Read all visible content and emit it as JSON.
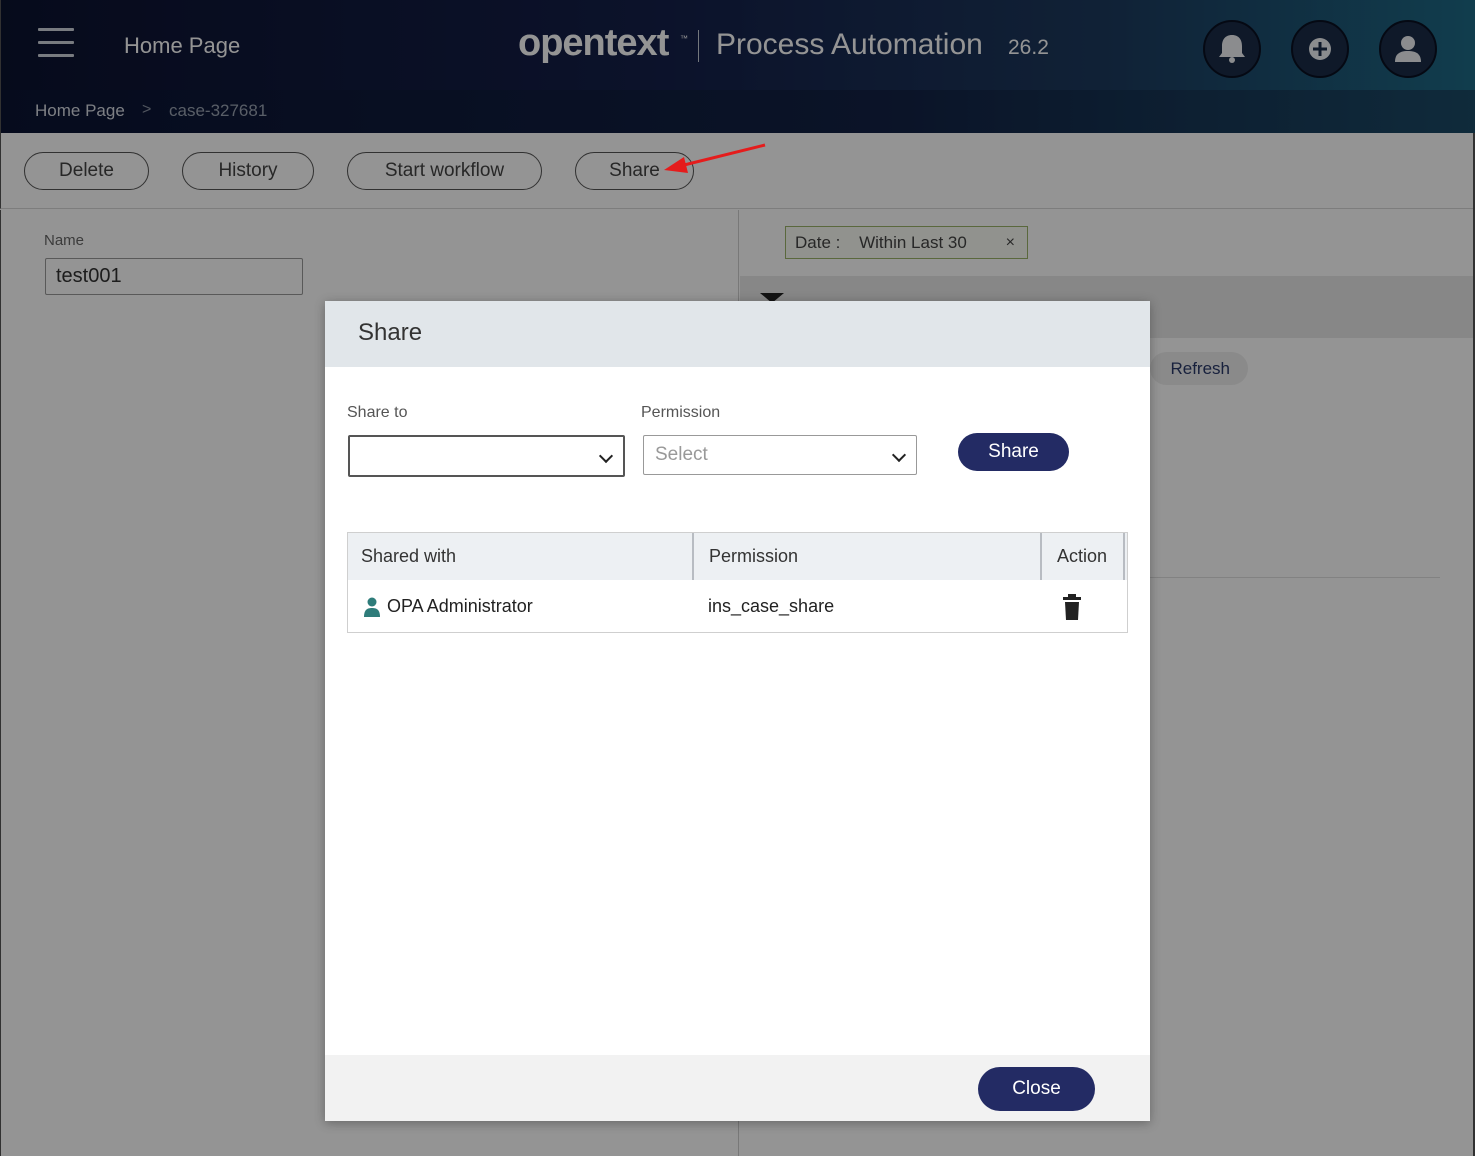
{
  "header": {
    "menu_icon": "hamburger-menu-icon",
    "page_title": "Home Page",
    "brand": "opentext",
    "brand_tm": "™",
    "product": "Process Automation",
    "version": "26.2",
    "buttons": [
      {
        "name": "notifications",
        "icon": "bell-icon"
      },
      {
        "name": "create",
        "icon": "plus-circle-icon"
      },
      {
        "name": "user",
        "icon": "user-icon"
      }
    ]
  },
  "breadcrumb": {
    "home": "Home Page",
    "separator": ">",
    "current": "case-327681"
  },
  "toolbar": {
    "delete_label": "Delete",
    "history_label": "History",
    "workflow_label": "Start workflow",
    "share_label": "Share"
  },
  "form": {
    "name_label": "Name",
    "name_value": "test001"
  },
  "right_panel": {
    "filter_label": "Date :",
    "filter_value": "Within Last 30",
    "filter_close": "×",
    "refresh_label": "Refresh"
  },
  "modal": {
    "title": "Share",
    "share_to_label": "Share to",
    "share_to_value": "",
    "permission_label": "Permission",
    "permission_placeholder": "Select",
    "share_button": "Share",
    "table": {
      "headers": [
        "Shared with",
        "Permission",
        "Action"
      ],
      "rows": [
        {
          "shared_with": "OPA Administrator",
          "permission": "ins_case_share",
          "action_icon": "trash-icon"
        }
      ]
    },
    "close_button": "Close"
  },
  "colors": {
    "primary_button": "#232b64",
    "header_gradient_start": "#0c1330",
    "header_gradient_end": "#1e6a86",
    "annotation_arrow": "#e51c1c",
    "user_icon": "#2e7c7a"
  }
}
